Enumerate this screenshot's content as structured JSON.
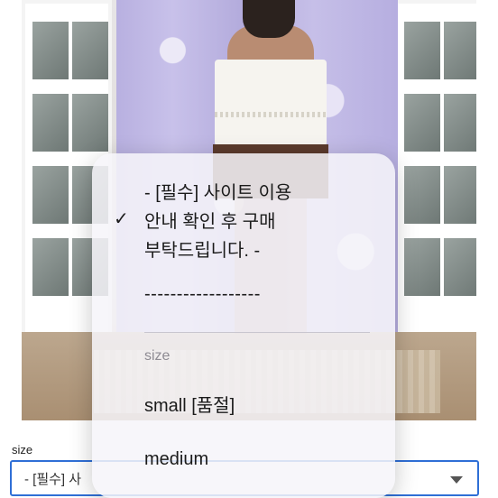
{
  "form": {
    "size_label": "size",
    "select_value": "- [필수] 사"
  },
  "dropdown": {
    "selected_option": {
      "line1": "- [필수] 사이트 이용",
      "line2": "안내 확인 후 구매",
      "line3": "부탁드립니다. -"
    },
    "checkmark": "✓",
    "separator_option": "------------------",
    "section_header": "size",
    "options": [
      "small [품절]",
      "medium"
    ]
  }
}
